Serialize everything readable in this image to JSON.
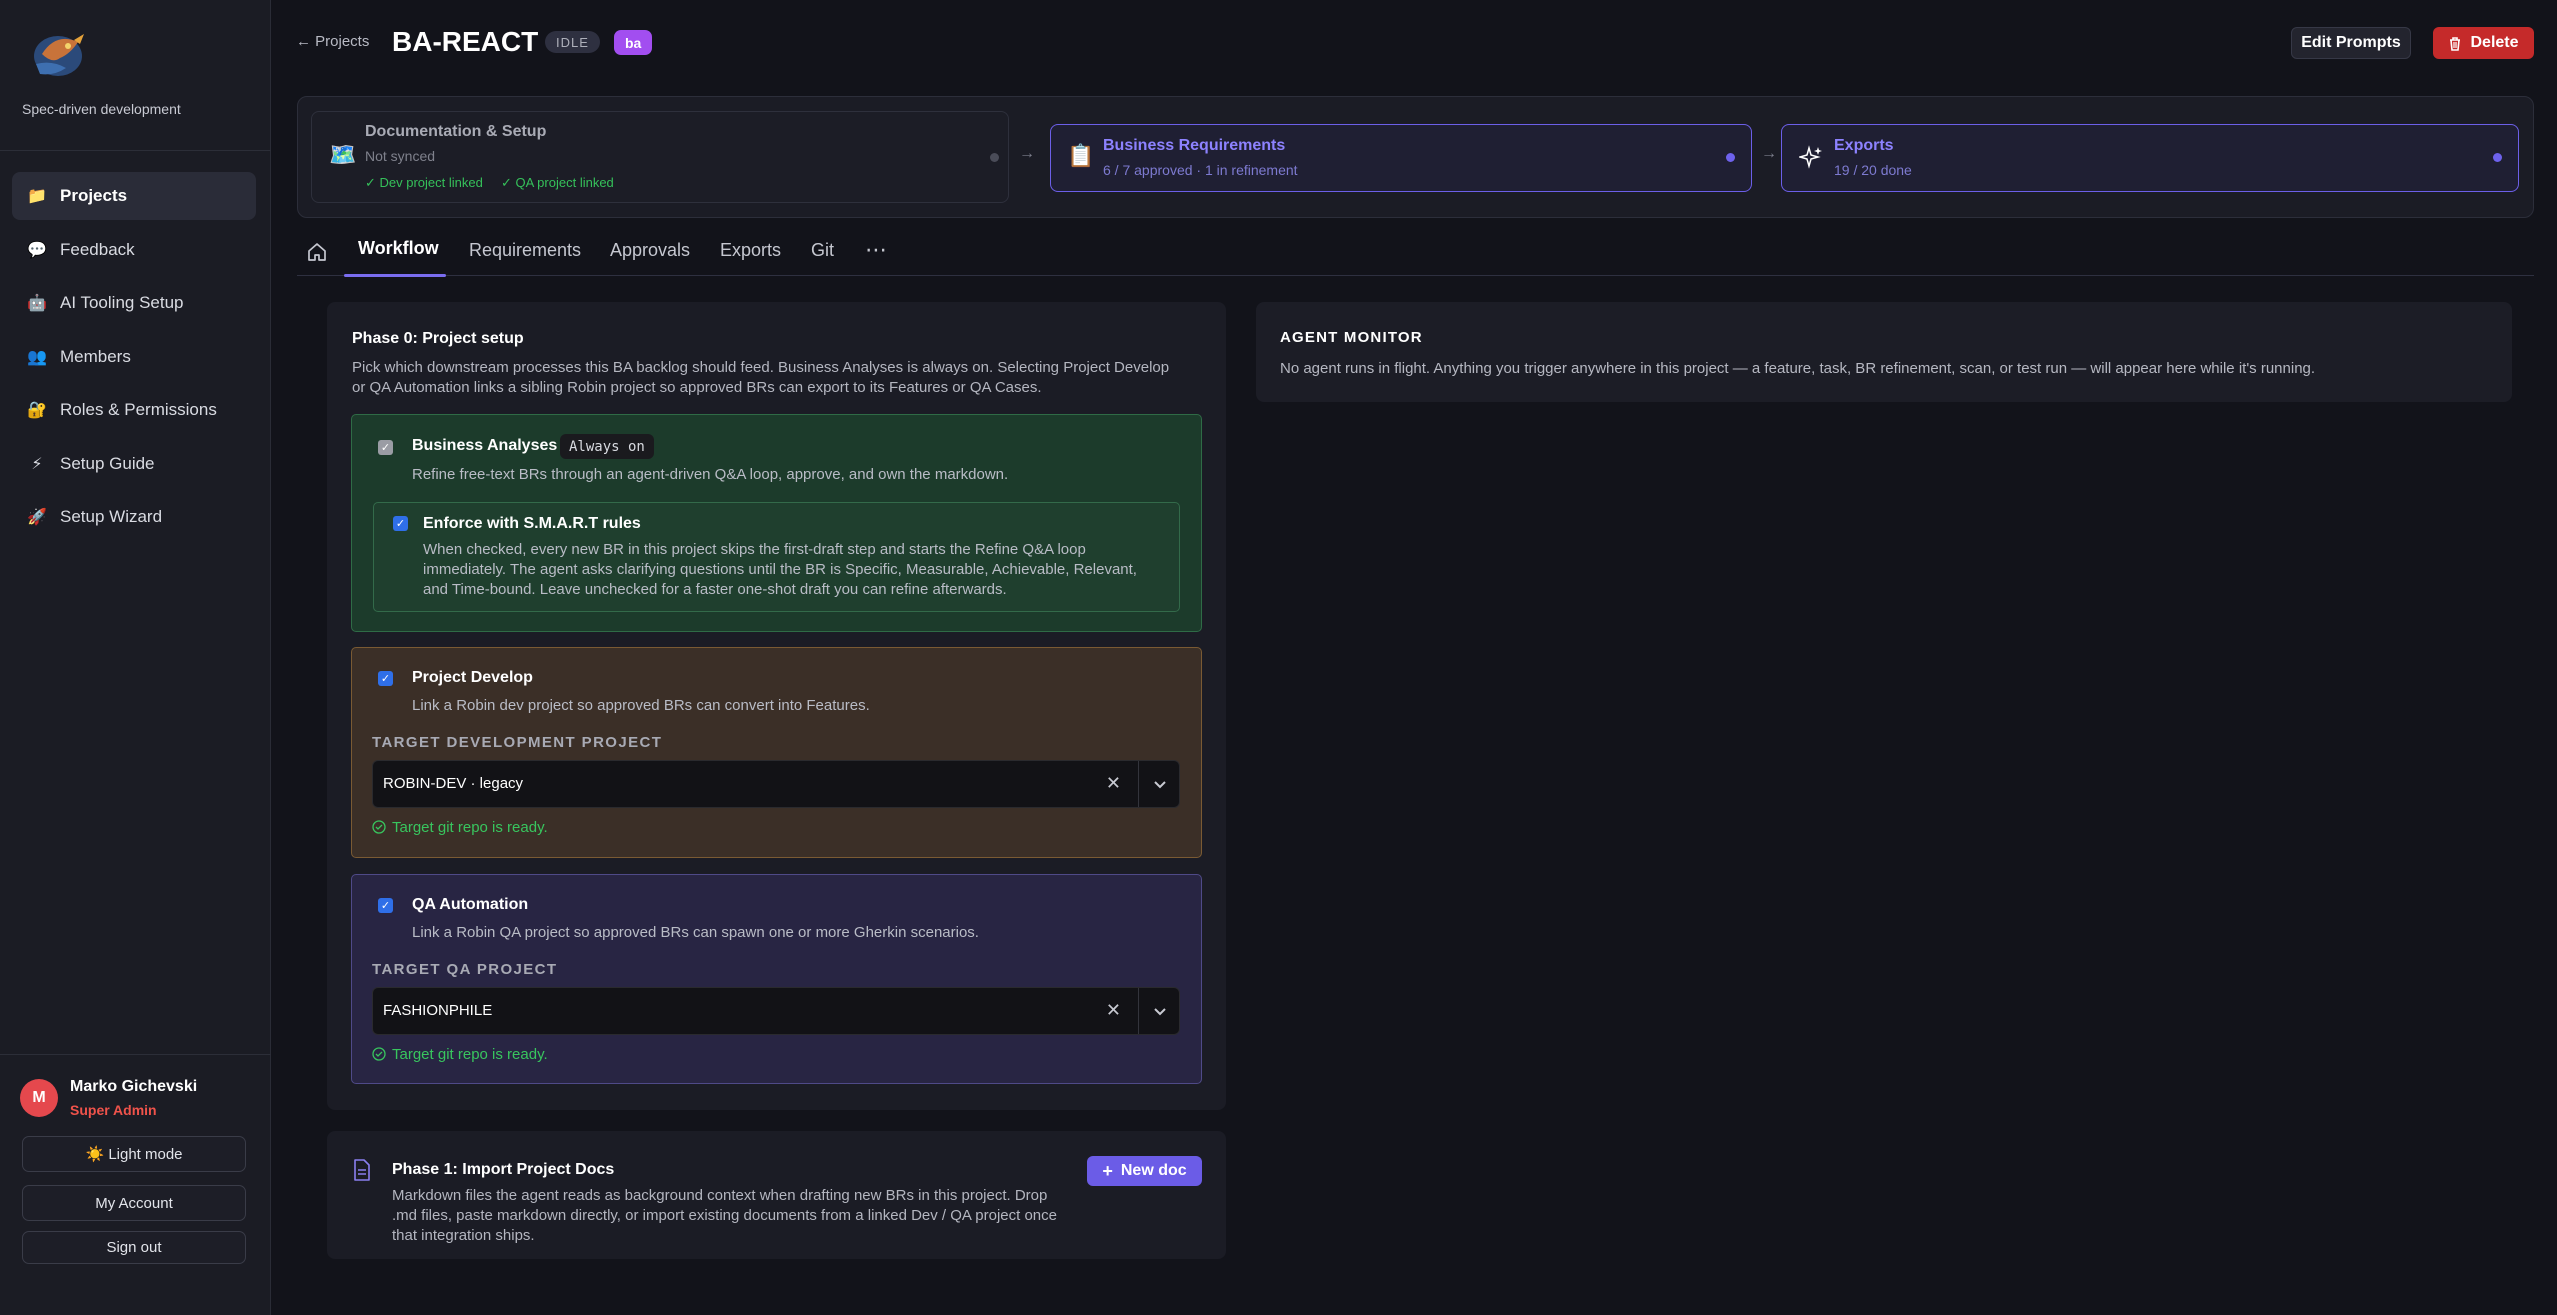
{
  "sidebar": {
    "tagline": "Spec-driven development",
    "items": [
      {
        "icon": "📁",
        "label": "Projects",
        "active": true
      },
      {
        "icon": "💬",
        "label": "Feedback"
      },
      {
        "icon": "🤖",
        "label": "AI Tooling Setup"
      },
      {
        "icon": "👥",
        "label": "Members"
      },
      {
        "icon": "🔐",
        "label": "Roles & Permissions"
      },
      {
        "icon": "⚡",
        "label": "Setup Guide"
      },
      {
        "icon": "🚀",
        "label": "Setup Wizard"
      }
    ],
    "user": {
      "initial": "M",
      "name": "Marko Gichevski",
      "role": "Super Admin"
    },
    "light_mode": "☀️ Light mode",
    "my_account": "My Account",
    "sign_out": "Sign out"
  },
  "header": {
    "back": "← Projects",
    "title": "BA-REACT",
    "status": "IDLE",
    "tag": "ba",
    "edit_prompts": "Edit Prompts",
    "delete": "Delete"
  },
  "pipeline": {
    "stages": [
      {
        "icon": "🗺️",
        "title": "Documentation & Setup",
        "sub": "Not synced",
        "links": [
          "✓ Dev project linked",
          "✓ QA project linked"
        ]
      },
      {
        "icon": "📋",
        "title": "Business Requirements",
        "sub": "6 / 7 approved · 1 in refinement"
      },
      {
        "icon": "sparkle-icon",
        "title": "Exports",
        "sub": "19 / 20 done"
      }
    ]
  },
  "tabs": [
    "Workflow",
    "Requirements",
    "Approvals",
    "Exports",
    "Git",
    "⋯"
  ],
  "phase0": {
    "title": "Phase 0: Project setup",
    "desc": "Pick which downstream processes this BA backlog should feed. Business Analyses is always on. Selecting Project Develop or QA Automation links a sibling Robin project so approved BRs can export to its Features or QA Cases.",
    "business": {
      "title": "Business Analyses",
      "badge": "Always on",
      "desc": "Refine free-text BRs through an agent-driven Q&A loop, approve, and own the markdown.",
      "smart_title": "Enforce with S.M.A.R.T rules",
      "smart_desc": "When checked, every new BR in this project skips the first-draft step and starts the Refine Q&A loop immediately. The agent asks clarifying questions until the BR is Specific, Measurable, Achievable, Relevant, and Time-bound. Leave unchecked for a faster one-shot draft you can refine afterwards."
    },
    "develop": {
      "title": "Project Develop",
      "desc": "Link a Robin dev project so approved BRs can convert into Features.",
      "label": "TARGET DEVELOPMENT PROJECT",
      "value": "ROBIN-DEV · legacy",
      "ready": "Target git repo is ready."
    },
    "qa": {
      "title": "QA Automation",
      "desc": "Link a Robin QA project so approved BRs can spawn one or more Gherkin scenarios.",
      "label": "TARGET QA PROJECT",
      "value": "FASHIONPHILE",
      "ready": "Target git repo is ready."
    }
  },
  "phase1": {
    "title": "Phase 1: Import Project Docs",
    "desc": "Markdown files the agent reads as background context when drafting new BRs in this project. Drop .md files, paste markdown directly, or import existing documents from a linked Dev / QA project once that integration ships.",
    "new_doc": "New doc"
  },
  "monitor": {
    "title": "AGENT MONITOR",
    "desc": "No agent runs in flight. Anything you trigger anywhere in this project — a feature, task, BR refinement, scan, or test run — will appear here while it's running."
  },
  "colors": {
    "accent": "#6b5ce7",
    "danger": "#c52a2a",
    "success": "#38c55e",
    "badge": "#a24ef0"
  }
}
